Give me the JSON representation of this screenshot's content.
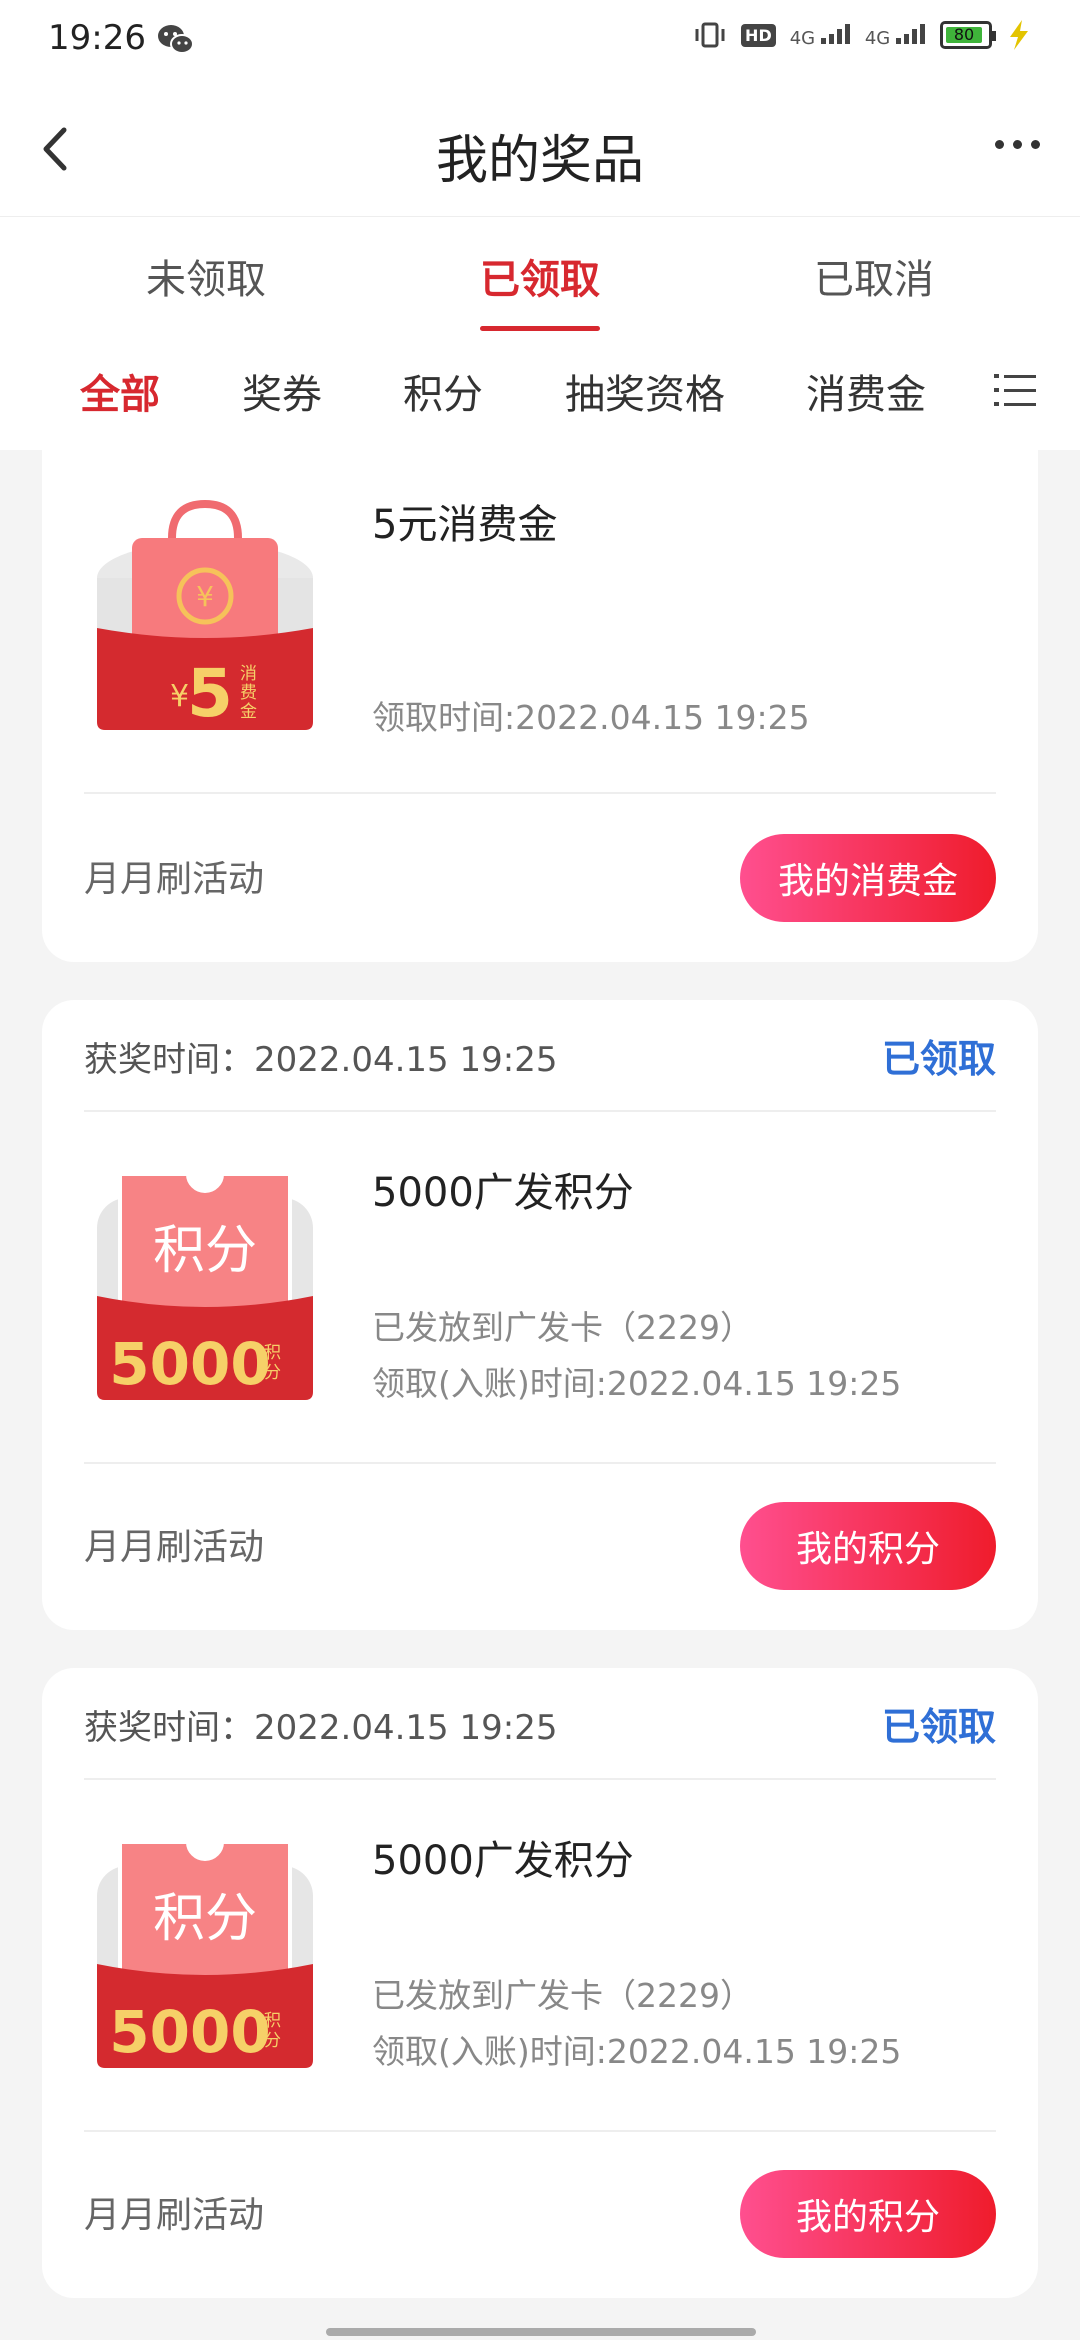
{
  "status": {
    "time": "19:26",
    "battery": "80",
    "net1": "4G",
    "net2": "4G",
    "hd": "HD"
  },
  "nav": {
    "title": "我的奖品"
  },
  "tabs": [
    "未领取",
    "已领取",
    "已取消"
  ],
  "filters": [
    "全部",
    "奖券",
    "积分",
    "抽奖资格",
    "消费金"
  ],
  "cards": [
    {
      "thumb": {
        "type": "voucher",
        "amount": "5",
        "currency": "¥",
        "unit_lines": [
          "消",
          "费",
          "金"
        ],
        "coin": "¥"
      },
      "name": "5元消费金",
      "info": [
        "领取时间:2022.04.15 19:25"
      ],
      "activity": "月月刷活动",
      "button": "我的消费金"
    },
    {
      "award_label": "获奖时间：2022.04.15 19:25",
      "state": "已领取",
      "thumb": {
        "type": "points",
        "title": "积分",
        "amount": "5000",
        "unit_lines": [
          "积",
          "分"
        ]
      },
      "name": "5000广发积分",
      "info": [
        "已发放到广发卡（2229）",
        "领取(入账)时间:2022.04.15 19:25"
      ],
      "activity": "月月刷活动",
      "button": "我的积分"
    },
    {
      "award_label": "获奖时间：2022.04.15 19:25",
      "state": "已领取",
      "thumb": {
        "type": "points",
        "title": "积分",
        "amount": "5000",
        "unit_lines": [
          "积",
          "分"
        ]
      },
      "name": "5000广发积分",
      "info": [
        "已发放到广发卡（2229）",
        "领取(入账)时间:2022.04.15 19:25"
      ],
      "activity": "月月刷活动",
      "button": "我的积分"
    }
  ],
  "colors": {
    "accent": "#d7282f",
    "state": "#2f6fd6",
    "button_start": "#ff4f8f",
    "button_end": "#ef1c2c"
  }
}
